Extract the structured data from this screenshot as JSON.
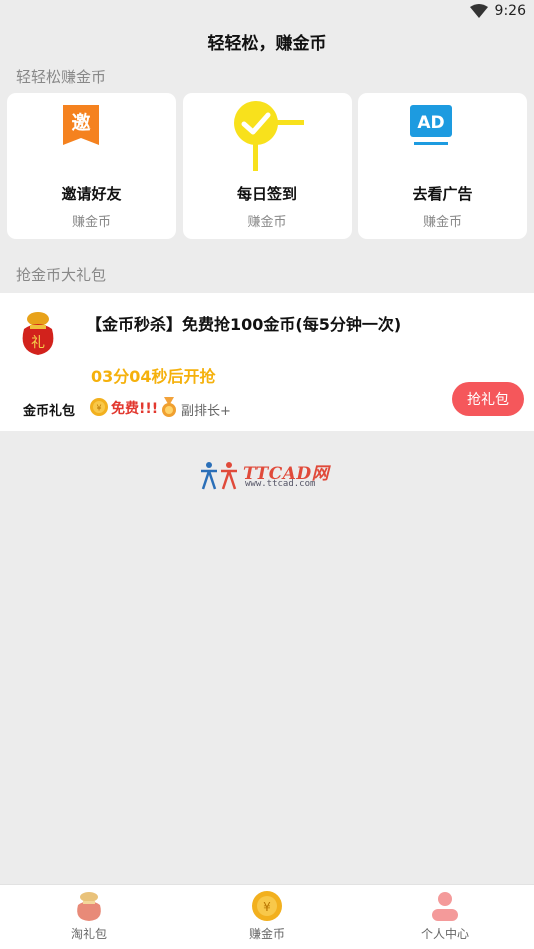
{
  "status_bar": {
    "time": "9:26",
    "wifi_icon": "wifi-icon"
  },
  "header": {
    "title": "轻轻松，赚金币"
  },
  "section_earn": {
    "label": "轻轻松赚金币",
    "cards": [
      {
        "title": "邀请好友",
        "subtitle": "赚金币",
        "icon": "invite-icon",
        "icon_text": "邀",
        "color": "#f5821f"
      },
      {
        "title": "每日签到",
        "subtitle": "赚金币",
        "icon": "checkin-icon",
        "color": "#f8e11c"
      },
      {
        "title": "去看广告",
        "subtitle": "赚金币",
        "icon": "ad-icon",
        "icon_text": "AD",
        "color": "#1d9be0"
      }
    ]
  },
  "section_gift": {
    "label": "抢金币大礼包",
    "item": {
      "title": "【金币秒杀】免费抢100金币(每5分钟一次)",
      "countdown": "03分04秒后开抢",
      "name": "金币礼包",
      "price": "免费!!!",
      "rank": "副排长+",
      "button": "抢礼包",
      "gift_bag_text": "礼",
      "coin_text": "¥"
    }
  },
  "watermark": {
    "brand": "TTCAD网",
    "url": "www.ttcad.com"
  },
  "tab_bar": {
    "tabs": [
      {
        "label": "淘礼包",
        "icon": "gift-bag-icon"
      },
      {
        "label": "赚金币",
        "icon": "coin-icon",
        "icon_text": "¥"
      },
      {
        "label": "个人中心",
        "icon": "user-icon"
      }
    ]
  },
  "colors": {
    "accent_red": "#f5575b",
    "countdown": "#f5b10c",
    "free": "#e2382f"
  }
}
